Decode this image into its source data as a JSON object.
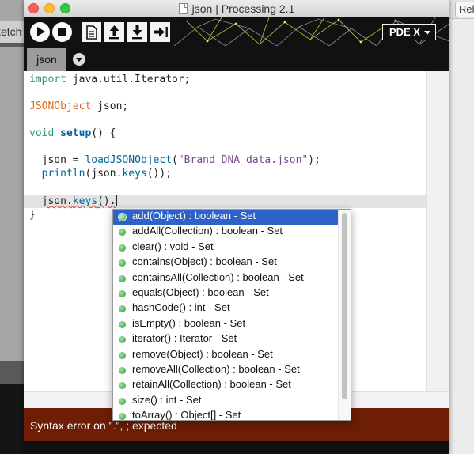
{
  "background": {
    "left_tab_text": "ketch",
    "right_button_text": "Rele"
  },
  "window": {
    "file_name": "json",
    "separator": "|",
    "app_name": "Processing 2.1"
  },
  "toolbar": {
    "run_icon": "play-icon",
    "stop_icon": "stop-icon",
    "new_icon": "new-sketch-icon",
    "open_icon": "open-arrow-up-icon",
    "save_icon": "save-arrow-down-icon",
    "export_icon": "export-arrow-right-icon",
    "mode_label": "PDE X"
  },
  "tabs": [
    {
      "label": "json"
    }
  ],
  "editor": {
    "code": {
      "import_kw": "import",
      "import_rest": " java.util.Iterator;",
      "decl_type": "JSONObject",
      "decl_rest": " json;",
      "void_kw": "void",
      "setup_name": "setup",
      "setup_rest": "() {",
      "l6_pre": "  json = ",
      "l6_fn": "loadJSONObject",
      "l6_open": "(",
      "l6_str": "\"Brand_DNA_data.json\"",
      "l6_close": ");",
      "l7_pre": "  ",
      "l7_fn": "println",
      "l7_mid": "(json.",
      "l7_keys": "keys",
      "l7_close": "());",
      "l9_pre": "  ",
      "l9_obj": "json.",
      "l9_keys": "keys",
      "l9_rest": "().",
      "close_brace": "}"
    }
  },
  "completion": {
    "items": [
      "add(Object) : boolean - Set",
      "addAll(Collection) : boolean - Set",
      "clear() : void - Set",
      "contains(Object) : boolean - Set",
      "containsAll(Collection) : boolean - Set",
      "equals(Object) : boolean - Set",
      "hashCode() : int - Set",
      "isEmpty() : boolean - Set",
      "iterator() : Iterator - Set",
      "remove(Object) : boolean - Set",
      "removeAll(Collection) : boolean - Set",
      "retainAll(Collection) : boolean - Set",
      "size() : int - Set",
      "toArray() : Object[] - Set"
    ],
    "selected_index": 0
  },
  "status": {
    "message": "Syntax error on \".\", ; expected"
  },
  "colors": {
    "keyword": "#33997e",
    "type": "#e2661a",
    "function": "#006699",
    "string": "#7d4793",
    "selection": "#2f62c9",
    "status_bar": "#6d1e04"
  }
}
